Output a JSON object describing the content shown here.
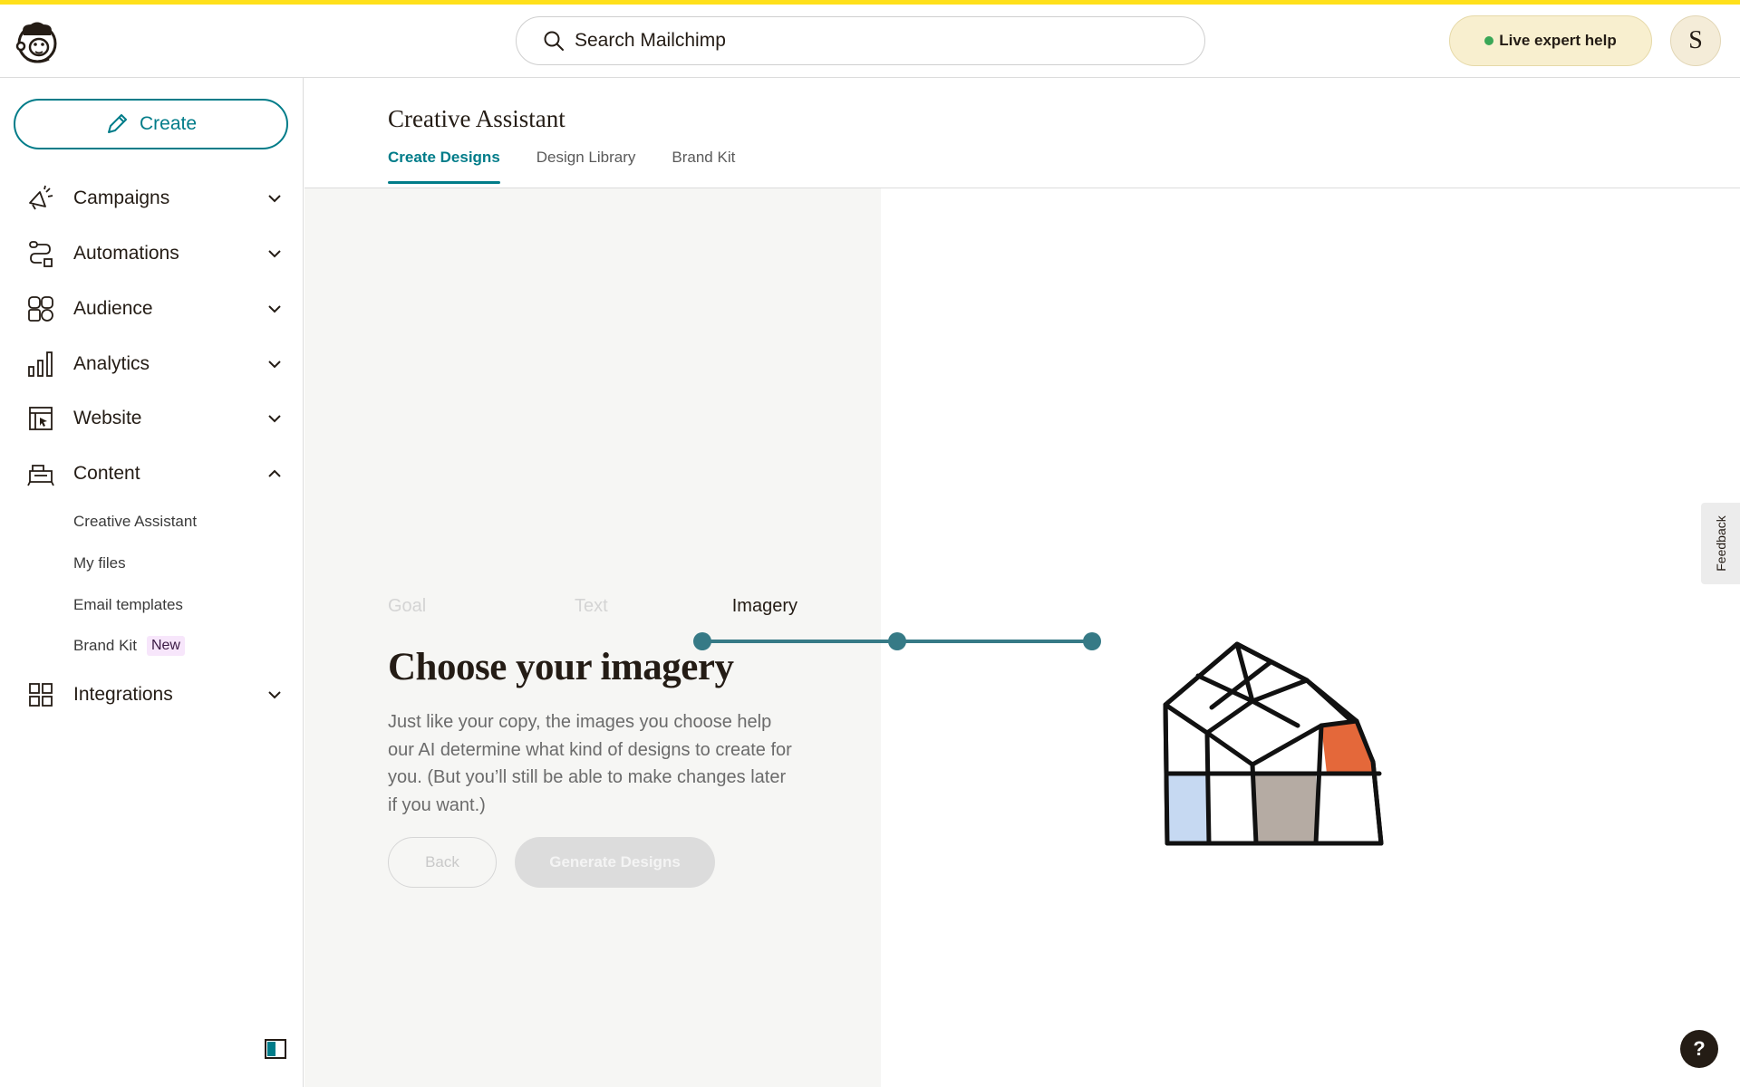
{
  "header": {
    "search_placeholder": "Search Mailchimp",
    "live_help_label": "Live expert help",
    "avatar_initial": "S"
  },
  "sidebar": {
    "create_label": "Create",
    "items": [
      {
        "label": "Campaigns",
        "icon": "megaphone-icon",
        "expanded": false
      },
      {
        "label": "Automations",
        "icon": "automation-icon",
        "expanded": false
      },
      {
        "label": "Audience",
        "icon": "audience-icon",
        "expanded": false
      },
      {
        "label": "Analytics",
        "icon": "bar-chart-icon",
        "expanded": false
      },
      {
        "label": "Website",
        "icon": "website-icon",
        "expanded": false
      },
      {
        "label": "Content",
        "icon": "content-icon",
        "expanded": true
      },
      {
        "label": "Integrations",
        "icon": "grid-icon",
        "expanded": false
      }
    ],
    "content_subitems": [
      {
        "label": "Creative Assistant"
      },
      {
        "label": "My files"
      },
      {
        "label": "Email templates"
      },
      {
        "label": "Brand Kit",
        "badge": "New"
      }
    ]
  },
  "main": {
    "title": "Creative Assistant",
    "tabs": [
      {
        "label": "Create Designs",
        "active": true
      },
      {
        "label": "Design Library",
        "active": false
      },
      {
        "label": "Brand Kit",
        "active": false
      }
    ],
    "steps": [
      {
        "label": "Goal"
      },
      {
        "label": "Text"
      },
      {
        "label": "Imagery"
      }
    ],
    "current_step": 3,
    "heading": "Choose your imagery",
    "description": "Just like your copy, the images you choose help our AI determine what kind of designs to create for you. (But you’ll still be able to make changes later if you want.)",
    "back_label": "Back",
    "generate_label": "Generate Designs"
  },
  "feedback_label": "Feedback",
  "help_label": "?",
  "colors": {
    "brand_yellow": "#ffe01b",
    "accent_teal": "#007c89",
    "progress_teal": "#367a86",
    "illustration_orange": "#e4683a",
    "illustration_blue": "#c6d9f2",
    "illustration_taupe": "#b5aba3"
  }
}
